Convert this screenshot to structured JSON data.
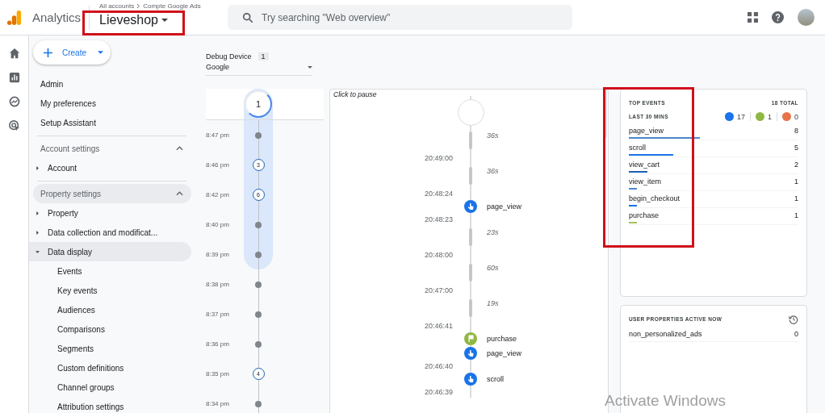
{
  "header": {
    "product": "Analytics",
    "breadcrumb": [
      "All accounts",
      "Compte Google Ads"
    ],
    "property": "Lieveshop",
    "search": {
      "placeholder": "Try searching \"Web overview\""
    }
  },
  "create_button": {
    "label": "Create"
  },
  "nav": [
    {
      "kind": "link",
      "label": "Admin",
      "selected": false
    },
    {
      "kind": "link",
      "label": "My preferences",
      "selected": false
    },
    {
      "kind": "link",
      "label": "Setup Assistant",
      "selected": false
    },
    {
      "kind": "section",
      "label": "Account settings",
      "selected": false,
      "expanded": true,
      "children": [
        {
          "kind": "group",
          "label": "Account",
          "selected": false,
          "expanded": false
        }
      ]
    },
    {
      "kind": "section",
      "label": "Property settings",
      "selected": true,
      "expanded": true,
      "children": [
        {
          "kind": "group",
          "label": "Property",
          "selected": false,
          "expanded": false
        },
        {
          "kind": "group",
          "label": "Data collection and modificat...",
          "selected": false,
          "expanded": false
        },
        {
          "kind": "group",
          "label": "Data display",
          "selected": true,
          "expanded": true,
          "children": [
            {
              "kind": "sub",
              "label": "Events",
              "selected": false
            },
            {
              "kind": "sub",
              "label": "Key events",
              "selected": false
            },
            {
              "kind": "sub",
              "label": "Audiences",
              "selected": false
            },
            {
              "kind": "sub",
              "label": "Comparisons",
              "selected": false
            },
            {
              "kind": "sub",
              "label": "Segments",
              "selected": false
            },
            {
              "kind": "sub",
              "label": "Custom definitions",
              "selected": false
            },
            {
              "kind": "sub",
              "label": "Channel groups",
              "selected": false
            },
            {
              "kind": "sub",
              "label": "Attribution settings",
              "selected": false
            }
          ]
        }
      ]
    }
  ],
  "debug_device": {
    "label": "Debug Device",
    "count": "1",
    "value": "Google"
  },
  "minutes": {
    "current": "1",
    "items": [
      {
        "time": "8:47 pm",
        "kind": "dot",
        "highlighted": true
      },
      {
        "time": "8:46 pm",
        "kind": "count",
        "count": "3",
        "highlighted": true
      },
      {
        "time": "8:42 pm",
        "kind": "count",
        "count": "6",
        "highlighted": true
      },
      {
        "time": "8:40 pm",
        "kind": "dot",
        "highlighted": true
      },
      {
        "time": "8:39 pm",
        "kind": "dot",
        "highlighted": true
      },
      {
        "time": "8:38 pm",
        "kind": "dot",
        "highlighted": false
      },
      {
        "time": "8:37 pm",
        "kind": "dot",
        "highlighted": false
      },
      {
        "time": "8:36 pm",
        "kind": "dot",
        "highlighted": false
      },
      {
        "time": "8:35 pm",
        "kind": "count",
        "count": "4",
        "highlighted": false
      },
      {
        "time": "8:34 pm",
        "kind": "dot",
        "highlighted": false
      }
    ]
  },
  "stream": {
    "pause_hint": "Click to pause",
    "rows": [
      {
        "kind": "gap",
        "text": "36s"
      },
      {
        "kind": "time",
        "text": "20:49:00"
      },
      {
        "kind": "gap",
        "text": "36s"
      },
      {
        "kind": "time",
        "text": "20:48:24"
      },
      {
        "kind": "event",
        "text": "page_view"
      },
      {
        "kind": "time",
        "text": "20:48:23"
      },
      {
        "kind": "gap",
        "text": "23s"
      },
      {
        "kind": "time",
        "text": "20:48:00"
      },
      {
        "kind": "gap",
        "text": "60s"
      },
      {
        "kind": "time",
        "text": "20:47:00"
      },
      {
        "kind": "gap",
        "text": "19s"
      },
      {
        "kind": "time",
        "text": "20:46:41"
      },
      {
        "kind": "conversion",
        "text": "purchase"
      },
      {
        "kind": "event",
        "text": "page_view"
      },
      {
        "kind": "time",
        "text": "20:46:40"
      },
      {
        "kind": "event",
        "text": "scroll"
      },
      {
        "kind": "time",
        "text": "20:46:39"
      }
    ]
  },
  "top_events": {
    "title": "TOP EVENTS",
    "total": "18 TOTAL",
    "period": "LAST 30 MINS",
    "counters": [
      {
        "kind": "event",
        "value": "17"
      },
      {
        "kind": "conversion",
        "value": "1"
      },
      {
        "kind": "error",
        "value": "0"
      }
    ],
    "rows": [
      {
        "name": "page_view",
        "count": "8",
        "level": 0.43,
        "color": "#4a86c8"
      },
      {
        "name": "scroll",
        "count": "5",
        "level": 0.27,
        "color": "#1a73e8"
      },
      {
        "name": "view_cart",
        "count": "2",
        "level": 0.11,
        "color": "#1a5fb4"
      },
      {
        "name": "view_item",
        "count": "1",
        "level": 0.05,
        "color": "#4a86c8"
      },
      {
        "name": "begin_checkout",
        "count": "1",
        "level": 0.05,
        "color": "#1a73e8"
      },
      {
        "name": "purchase",
        "count": "1",
        "level": 0.05,
        "color": "#a5c25c"
      }
    ]
  },
  "user_properties": {
    "title": "USER PROPERTIES ACTIVE NOW",
    "rows": [
      {
        "name": "non_personalized_ads",
        "value": "0"
      }
    ]
  },
  "os_notice": "Activate Windows"
}
